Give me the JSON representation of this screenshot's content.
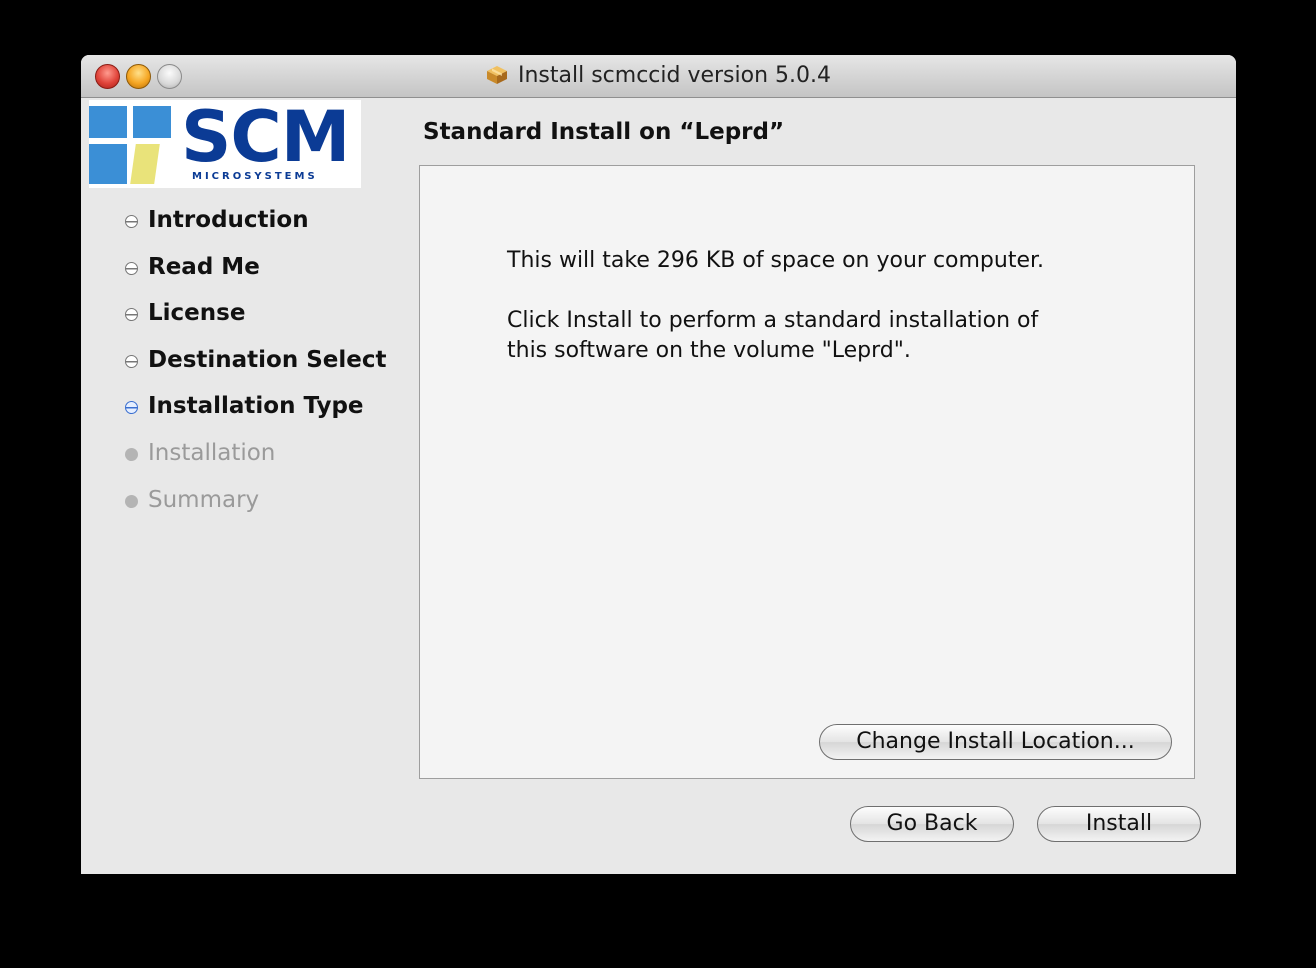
{
  "window": {
    "title": "Install scmccid version 5.0.4",
    "title_icon": "package-icon"
  },
  "logo": {
    "text": "SCM",
    "subtext": "MICROSYSTEMS"
  },
  "steps": [
    {
      "label": "Introduction",
      "state": "done"
    },
    {
      "label": "Read Me",
      "state": "done"
    },
    {
      "label": "License",
      "state": "done"
    },
    {
      "label": "Destination Select",
      "state": "done"
    },
    {
      "label": "Installation Type",
      "state": "current"
    },
    {
      "label": "Installation",
      "state": "future"
    },
    {
      "label": "Summary",
      "state": "future"
    }
  ],
  "main": {
    "heading": "Standard Install on “Leprd”",
    "line1": "This will take 296 KB of space on your computer.",
    "line2a": "Click Install to perform a standard installation of",
    "line2b": "this software on the volume \"Leprd\".",
    "change_location_label": "Change Install Location..."
  },
  "buttons": {
    "go_back": "Go Back",
    "install": "Install"
  },
  "colors": {
    "logo_blue": "#0b3b95",
    "logo_square_blue": "#3b8fd6",
    "logo_square_yellow": "#e9e37a",
    "current_step": "#3a6fd0"
  }
}
